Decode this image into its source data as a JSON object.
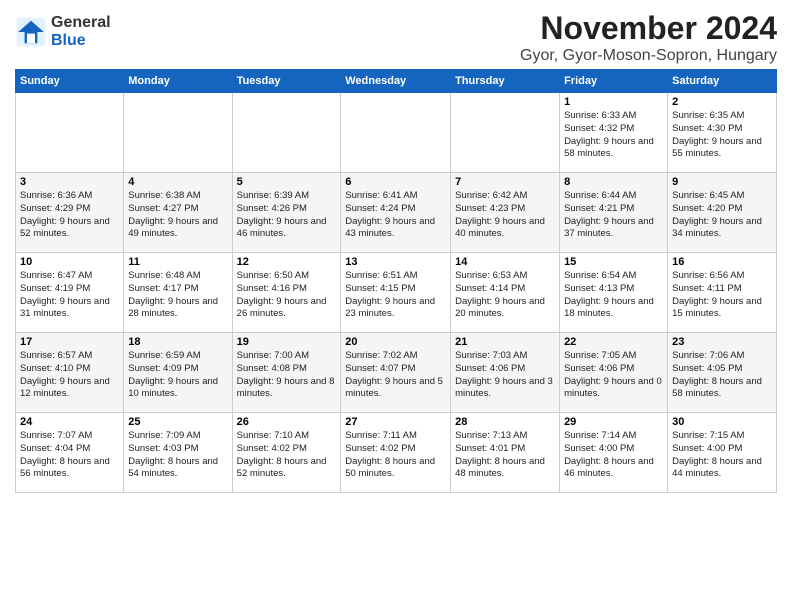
{
  "logo": {
    "general": "General",
    "blue": "Blue"
  },
  "title": "November 2024",
  "subtitle": "Gyor, Gyor-Moson-Sopron, Hungary",
  "days_of_week": [
    "Sunday",
    "Monday",
    "Tuesday",
    "Wednesday",
    "Thursday",
    "Friday",
    "Saturday"
  ],
  "weeks": [
    [
      {
        "day": "",
        "info": ""
      },
      {
        "day": "",
        "info": ""
      },
      {
        "day": "",
        "info": ""
      },
      {
        "day": "",
        "info": ""
      },
      {
        "day": "",
        "info": ""
      },
      {
        "day": "1",
        "info": "Sunrise: 6:33 AM\nSunset: 4:32 PM\nDaylight: 9 hours and 58 minutes."
      },
      {
        "day": "2",
        "info": "Sunrise: 6:35 AM\nSunset: 4:30 PM\nDaylight: 9 hours and 55 minutes."
      }
    ],
    [
      {
        "day": "3",
        "info": "Sunrise: 6:36 AM\nSunset: 4:29 PM\nDaylight: 9 hours and 52 minutes."
      },
      {
        "day": "4",
        "info": "Sunrise: 6:38 AM\nSunset: 4:27 PM\nDaylight: 9 hours and 49 minutes."
      },
      {
        "day": "5",
        "info": "Sunrise: 6:39 AM\nSunset: 4:26 PM\nDaylight: 9 hours and 46 minutes."
      },
      {
        "day": "6",
        "info": "Sunrise: 6:41 AM\nSunset: 4:24 PM\nDaylight: 9 hours and 43 minutes."
      },
      {
        "day": "7",
        "info": "Sunrise: 6:42 AM\nSunset: 4:23 PM\nDaylight: 9 hours and 40 minutes."
      },
      {
        "day": "8",
        "info": "Sunrise: 6:44 AM\nSunset: 4:21 PM\nDaylight: 9 hours and 37 minutes."
      },
      {
        "day": "9",
        "info": "Sunrise: 6:45 AM\nSunset: 4:20 PM\nDaylight: 9 hours and 34 minutes."
      }
    ],
    [
      {
        "day": "10",
        "info": "Sunrise: 6:47 AM\nSunset: 4:19 PM\nDaylight: 9 hours and 31 minutes."
      },
      {
        "day": "11",
        "info": "Sunrise: 6:48 AM\nSunset: 4:17 PM\nDaylight: 9 hours and 28 minutes."
      },
      {
        "day": "12",
        "info": "Sunrise: 6:50 AM\nSunset: 4:16 PM\nDaylight: 9 hours and 26 minutes."
      },
      {
        "day": "13",
        "info": "Sunrise: 6:51 AM\nSunset: 4:15 PM\nDaylight: 9 hours and 23 minutes."
      },
      {
        "day": "14",
        "info": "Sunrise: 6:53 AM\nSunset: 4:14 PM\nDaylight: 9 hours and 20 minutes."
      },
      {
        "day": "15",
        "info": "Sunrise: 6:54 AM\nSunset: 4:13 PM\nDaylight: 9 hours and 18 minutes."
      },
      {
        "day": "16",
        "info": "Sunrise: 6:56 AM\nSunset: 4:11 PM\nDaylight: 9 hours and 15 minutes."
      }
    ],
    [
      {
        "day": "17",
        "info": "Sunrise: 6:57 AM\nSunset: 4:10 PM\nDaylight: 9 hours and 12 minutes."
      },
      {
        "day": "18",
        "info": "Sunrise: 6:59 AM\nSunset: 4:09 PM\nDaylight: 9 hours and 10 minutes."
      },
      {
        "day": "19",
        "info": "Sunrise: 7:00 AM\nSunset: 4:08 PM\nDaylight: 9 hours and 8 minutes."
      },
      {
        "day": "20",
        "info": "Sunrise: 7:02 AM\nSunset: 4:07 PM\nDaylight: 9 hours and 5 minutes."
      },
      {
        "day": "21",
        "info": "Sunrise: 7:03 AM\nSunset: 4:06 PM\nDaylight: 9 hours and 3 minutes."
      },
      {
        "day": "22",
        "info": "Sunrise: 7:05 AM\nSunset: 4:06 PM\nDaylight: 9 hours and 0 minutes."
      },
      {
        "day": "23",
        "info": "Sunrise: 7:06 AM\nSunset: 4:05 PM\nDaylight: 8 hours and 58 minutes."
      }
    ],
    [
      {
        "day": "24",
        "info": "Sunrise: 7:07 AM\nSunset: 4:04 PM\nDaylight: 8 hours and 56 minutes."
      },
      {
        "day": "25",
        "info": "Sunrise: 7:09 AM\nSunset: 4:03 PM\nDaylight: 8 hours and 54 minutes."
      },
      {
        "day": "26",
        "info": "Sunrise: 7:10 AM\nSunset: 4:02 PM\nDaylight: 8 hours and 52 minutes."
      },
      {
        "day": "27",
        "info": "Sunrise: 7:11 AM\nSunset: 4:02 PM\nDaylight: 8 hours and 50 minutes."
      },
      {
        "day": "28",
        "info": "Sunrise: 7:13 AM\nSunset: 4:01 PM\nDaylight: 8 hours and 48 minutes."
      },
      {
        "day": "29",
        "info": "Sunrise: 7:14 AM\nSunset: 4:00 PM\nDaylight: 8 hours and 46 minutes."
      },
      {
        "day": "30",
        "info": "Sunrise: 7:15 AM\nSunset: 4:00 PM\nDaylight: 8 hours and 44 minutes."
      }
    ]
  ]
}
